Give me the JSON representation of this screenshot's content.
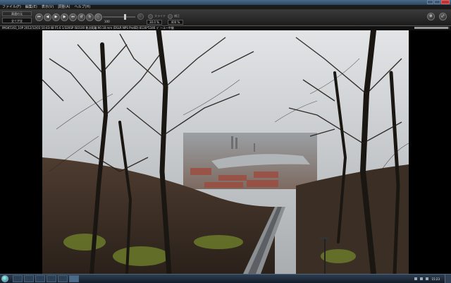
{
  "window": {
    "title": ""
  },
  "menu": [
    "ファイル(F)",
    "編集(E)",
    "表示(V)",
    "調整(A)",
    "ヘルプ(H)"
  ],
  "toolbar": {
    "mode_label": "高速の元",
    "mode_value": "全てが全",
    "nav_buttons": [
      "first",
      "prev",
      "play",
      "next",
      "last",
      "rotate-left",
      "rotate-right"
    ],
    "slider_label": "100",
    "toggle1_label": "スライド",
    "toggle2_label": "補正",
    "value1": "30.0 %",
    "value2": "400 %"
  },
  "info": {
    "text": "IMGK5161_10P 2012/12/03 10:43:48 F5.6 1/320SP ISO100 焦点距離:90.18 mm (DSLR NPS Pro6D) 8136*5346 イ ーユー中後",
    "progress": 0.95
  },
  "taskbar": {
    "clock": "15:23"
  }
}
